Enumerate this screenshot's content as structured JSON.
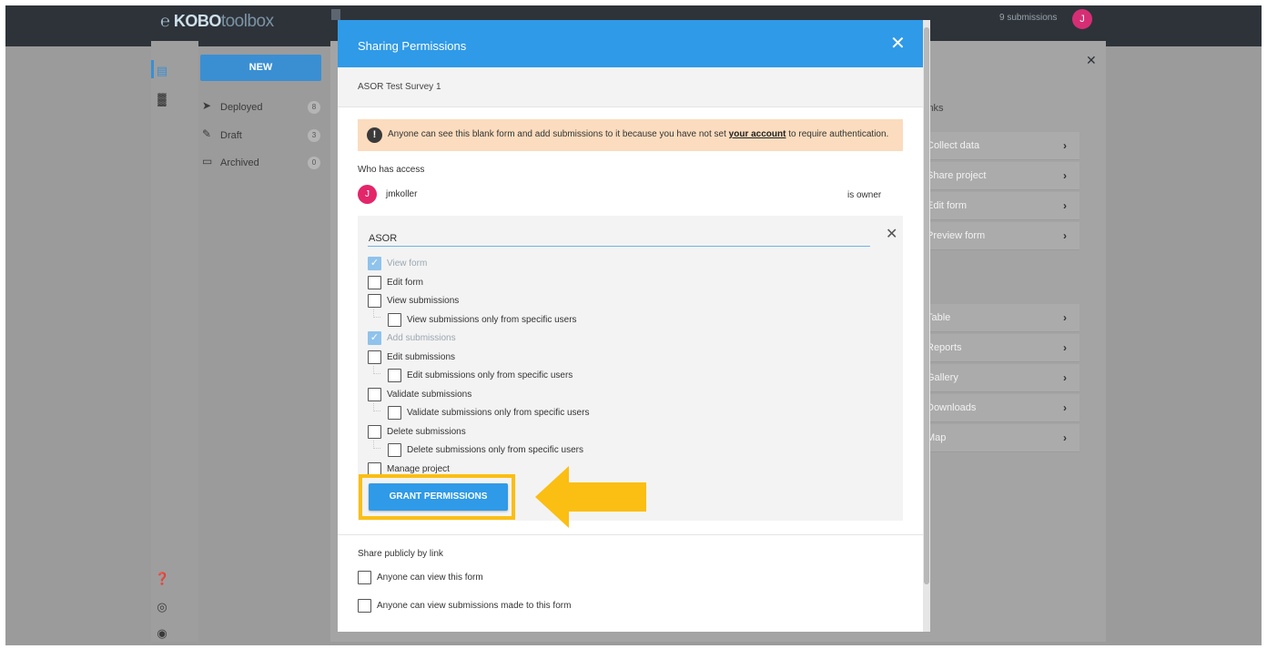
{
  "app": {
    "logo_k": "KOBO",
    "logo_toolbox": "toolbox",
    "submissions_count": "9 submissions",
    "user_initial": "J"
  },
  "sidebar": {
    "new_label": "NEW",
    "items": [
      {
        "label": "Deployed",
        "count": "8",
        "icon": "deployed-icon"
      },
      {
        "label": "Draft",
        "count": "3",
        "icon": "draft-icon"
      },
      {
        "label": "Archived",
        "count": "0",
        "icon": "archived-icon"
      }
    ]
  },
  "project_links": {
    "title": "inks",
    "primary": [
      "Collect data",
      "Share project",
      "Edit form",
      "Preview form"
    ],
    "data": [
      "Table",
      "Reports",
      "Gallery",
      "Downloads",
      "Map"
    ]
  },
  "modal": {
    "title": "Sharing Permissions",
    "close_symbol": "✕",
    "subtitle": "ASOR Test Survey 1",
    "warning": {
      "before": "Anyone can see this blank form and add submissions to it because you have not set ",
      "link": "your account",
      "after": " to require authentication.",
      "icon": "!"
    },
    "who_has_access": "Who has access",
    "owner": {
      "initial": "J",
      "name": "jmkoller",
      "role": "is owner"
    },
    "permission_search": {
      "value": "ASOR",
      "clear_symbol": "✕"
    },
    "permissions": [
      {
        "label": "View form",
        "checked": true,
        "disabled": true,
        "child": false
      },
      {
        "label": "Edit form",
        "checked": false,
        "disabled": false,
        "child": false
      },
      {
        "label": "View submissions",
        "checked": false,
        "disabled": false,
        "child": false
      },
      {
        "label": "View submissions only from specific users",
        "checked": false,
        "disabled": false,
        "child": true
      },
      {
        "label": "Add submissions",
        "checked": true,
        "disabled": true,
        "child": false
      },
      {
        "label": "Edit submissions",
        "checked": false,
        "disabled": false,
        "child": false
      },
      {
        "label": "Edit submissions only from specific users",
        "checked": false,
        "disabled": false,
        "child": true
      },
      {
        "label": "Validate submissions",
        "checked": false,
        "disabled": false,
        "child": false
      },
      {
        "label": "Validate submissions only from specific users",
        "checked": false,
        "disabled": false,
        "child": true
      },
      {
        "label": "Delete submissions",
        "checked": false,
        "disabled": false,
        "child": false
      },
      {
        "label": "Delete submissions only from specific users",
        "checked": false,
        "disabled": false,
        "child": true
      },
      {
        "label": "Manage project",
        "checked": false,
        "disabled": false,
        "child": false
      }
    ],
    "grant_button": "GRANT PERMISSIONS",
    "share_publicly": {
      "title": "Share publicly by link",
      "options": [
        "Anyone can view this form",
        "Anyone can view submissions made to this form"
      ]
    }
  },
  "colors": {
    "header_blue": "#2f9ae7",
    "annotation_yellow": "#fbbe12",
    "warning_bg": "#fbdcbe",
    "owner_pink": "#e3266a"
  }
}
